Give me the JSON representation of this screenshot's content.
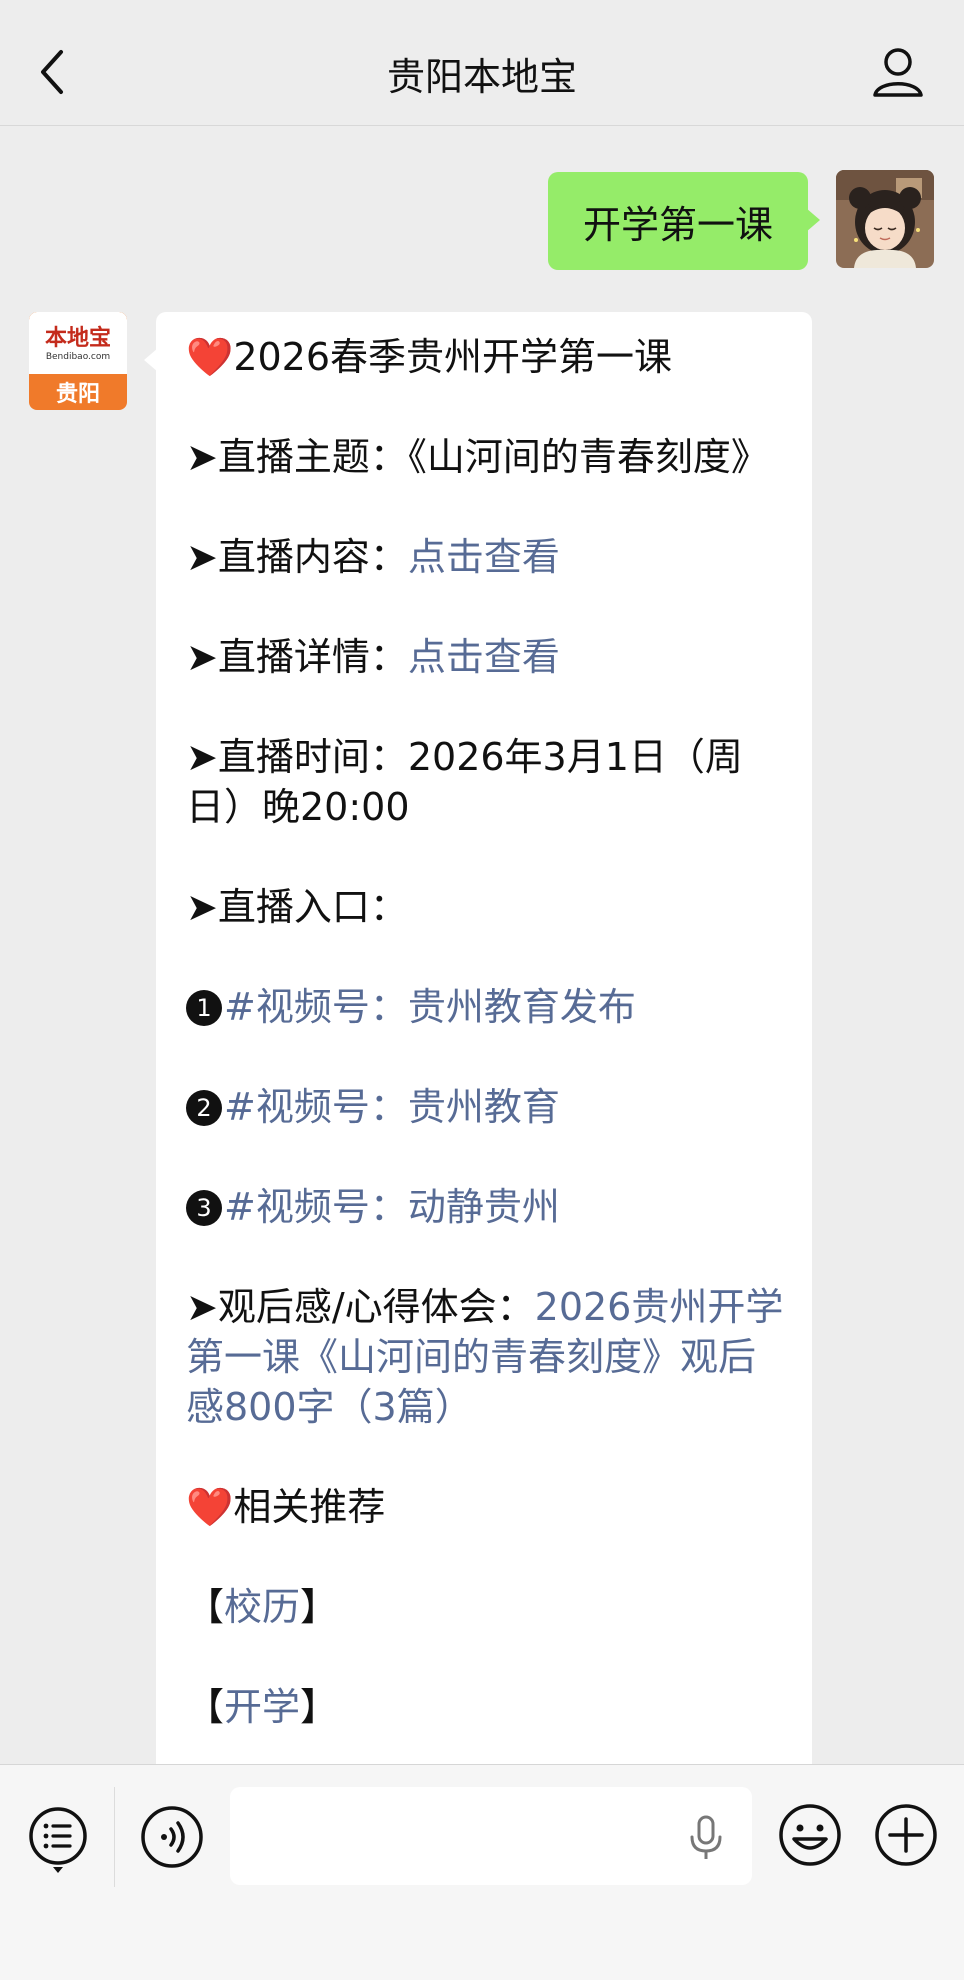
{
  "header": {
    "title": "贵阳本地宝"
  },
  "outgoing": {
    "text": "开学第一课"
  },
  "bot_avatar": {
    "logo": "本地宝",
    "site": "Bendibao.com",
    "city": "贵阳"
  },
  "message": {
    "heading": "2026春季贵州开学第一课",
    "theme_label": "➤直播主题：",
    "theme_value": "《山河间的青春刻度》",
    "content_label": "➤直播内容：",
    "content_link": "点击查看",
    "details_label": "➤直播详情：",
    "details_link": "点击查看",
    "time_label": "➤直播时间：",
    "time_value": "2026年3月1日（周日）晚20:00",
    "entry_label": "➤直播入口：",
    "channels": [
      {
        "num": "1",
        "prefix": "#视频号：",
        "name": "贵州教育发布"
      },
      {
        "num": "2",
        "prefix": "#视频号：",
        "name": "贵州教育"
      },
      {
        "num": "3",
        "prefix": "#视频号：",
        "name": "动静贵州"
      }
    ],
    "review_label": "➤观后感/心得体会：",
    "review_link": "2026贵州开学第一课《山河间的青春刻度》观后感800字（3篇）",
    "related_heading": "相关推荐",
    "related": [
      {
        "open": "【",
        "label": "校历",
        "close": "】"
      },
      {
        "open": "【",
        "label": "开学",
        "close": "】"
      }
    ]
  },
  "icons": {
    "back": "chevron-left-icon",
    "profile": "person-icon",
    "menu": "list-icon",
    "voice": "voice-icon",
    "mic": "microphone-icon",
    "emoji": "emoji-icon",
    "add": "plus-icon"
  },
  "colors": {
    "background": "#ededed",
    "outgoing_bubble": "#95ec69",
    "link": "#576b95",
    "heart": "#e0202a",
    "brand_orange": "#f07a2a"
  }
}
